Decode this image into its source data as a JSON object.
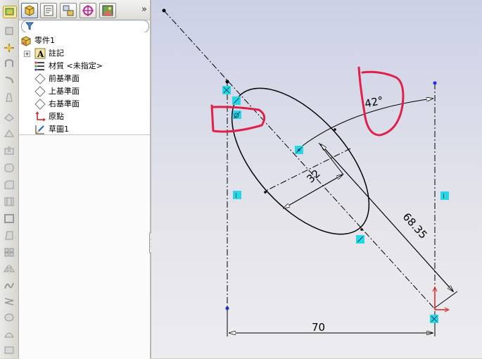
{
  "feature_tree": {
    "items": [
      {
        "label": "零件1",
        "icon": "part-icon"
      },
      {
        "label": "註記",
        "icon": "annotations-icon"
      },
      {
        "label": "材質 <未指定>",
        "icon": "material-icon"
      },
      {
        "label": "前基準面",
        "icon": "plane-icon"
      },
      {
        "label": "上基準面",
        "icon": "plane-icon"
      },
      {
        "label": "右基準面",
        "icon": "plane-icon"
      },
      {
        "label": "原點",
        "icon": "origin-icon"
      },
      {
        "label": "草圖1",
        "icon": "sketch-icon"
      }
    ],
    "more_label": "»"
  },
  "sketch": {
    "angle_dim": "42°",
    "minor_axis_dim": "32",
    "diagonal_dim": "68.35",
    "width_dim": "70",
    "vertical_relation": "I"
  },
  "colors": {
    "annotation_red": "#e0204a",
    "relation_cyan": "#29d6e6",
    "point_blue": "#1f2fd0",
    "origin_red": "#e02020"
  }
}
